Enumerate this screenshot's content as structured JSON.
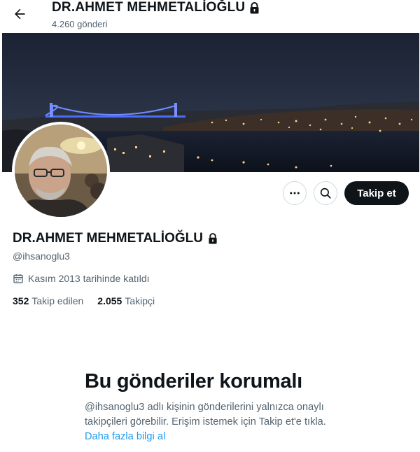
{
  "header": {
    "title": "DR.AHMET MEHMETALİOĞLU",
    "post_count": "4.260 gönderi"
  },
  "icons": {
    "back": "arrow-left-icon",
    "lock": "lock-icon",
    "more": "more-horizontal-icon",
    "search": "search-icon",
    "calendar": "calendar-icon"
  },
  "profile": {
    "name": "DR.AHMET MEHMETALİOĞLU",
    "handle": "@ihsanoglu3",
    "joined": "Kasım 2013 tarihinde katıldı",
    "following_count": "352",
    "following_label": "Takip edilen",
    "followers_count": "2.055",
    "followers_label": "Takipçi"
  },
  "actions": {
    "follow_label": "Takip et"
  },
  "protected": {
    "title": "Bu gönderiler korumalı",
    "body": "@ihsanoglu3 adlı kişinin gönderilerini yalnızca onaylı takipçileri görebilir. Erişim istemek için Takip et'e tıkla.",
    "learn_more": "Daha fazla bilgi al"
  },
  "colors": {
    "text_primary": "#0f1419",
    "text_secondary": "#536471",
    "link": "#1d9bf0",
    "button_dark": "#0f1419",
    "border": "#cfd9de"
  }
}
